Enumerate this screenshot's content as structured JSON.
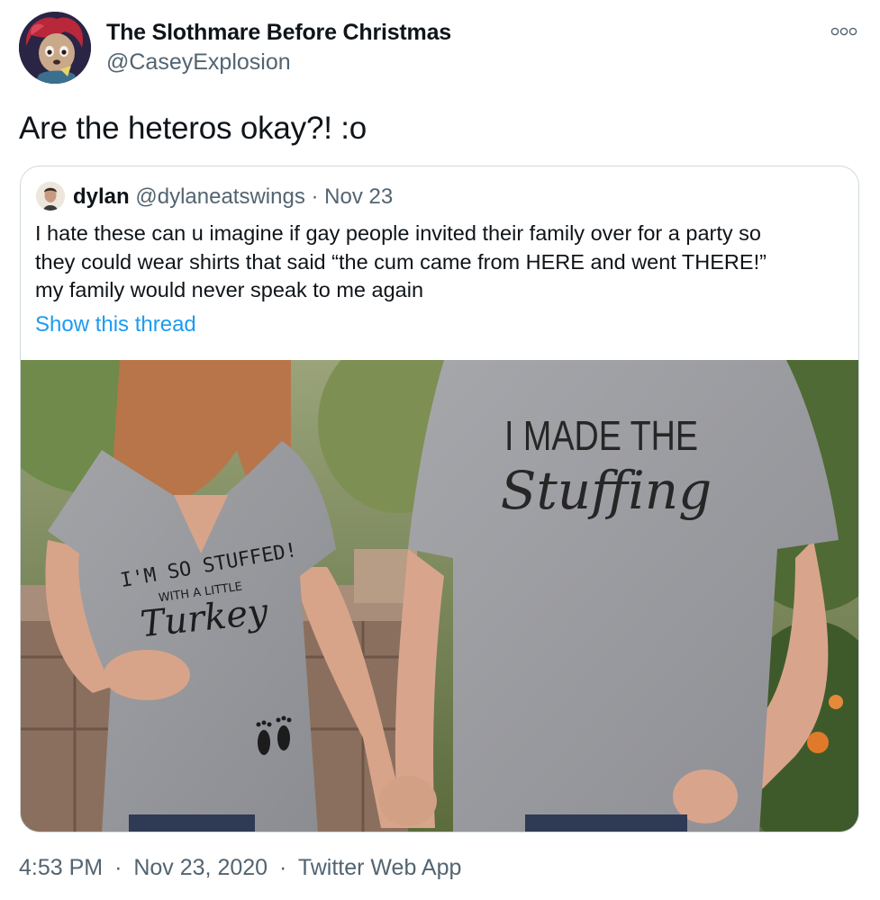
{
  "author": {
    "name": "The Slothmare Before Christmas",
    "handle": "@CaseyExplosion"
  },
  "tweet": {
    "text": "Are the heteros okay?! :o"
  },
  "quoted": {
    "name": "dylan",
    "handle": "@dylaneatswings",
    "separator": "·",
    "date": "Nov 23",
    "lines": [
      "I hate these can u imagine if gay people invited their family over for a party so",
      "they could wear shirts that said “the cum came from HERE and went THERE!”",
      "my family would never speak to me again"
    ],
    "show_thread": "Show this thread",
    "photo": {
      "shirt_left_line1": "I'M SO STUFFED!",
      "shirt_left_line2": "WITH A LITTLE",
      "shirt_left_line3": "Turkey",
      "shirt_right_line1": "I MADE THE",
      "shirt_right_line2": "Stuffing"
    }
  },
  "footer": {
    "time": "4:53 PM",
    "sep1": "·",
    "date": "Nov 23, 2020",
    "sep2": "·",
    "source": "Twitter Web App"
  },
  "icons": {
    "more": "more-horizontal-icon"
  },
  "colors": {
    "link": "#1d9bf0",
    "secondary_text": "#536471",
    "card_border": "#cfd9de"
  }
}
